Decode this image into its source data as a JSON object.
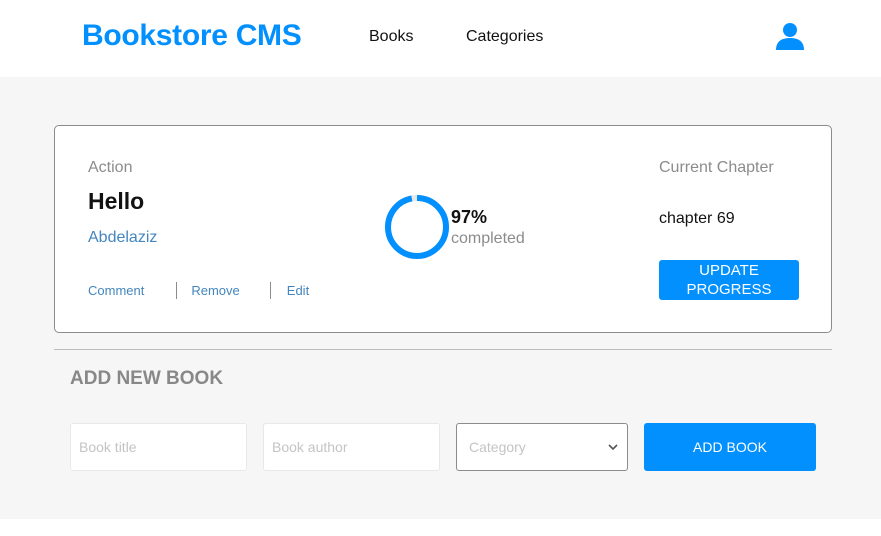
{
  "header": {
    "logo": "Bookstore CMS",
    "nav": [
      {
        "label": "Books"
      },
      {
        "label": "Categories"
      }
    ],
    "user_icon": "user-icon"
  },
  "book": {
    "genre": "Action",
    "title": "Hello",
    "author": "Abdelaziz",
    "actions": [
      "Comment",
      "Remove",
      "Edit"
    ],
    "progress_percent": "97%",
    "progress_value": 0.97,
    "progress_label": "completed",
    "current_chapter_label": "Current Chapter",
    "current_chapter": "chapter 69",
    "update_button": "UPDATE PROGRESS"
  },
  "form": {
    "title": "ADD NEW BOOK",
    "title_placeholder": "Book title",
    "author_placeholder": "Book author",
    "category_placeholder": "Category",
    "submit_label": "ADD BOOK"
  },
  "colors": {
    "accent": "#0290ff",
    "link": "#4386bf",
    "muted": "#8c8c8c",
    "background": "#f6f6f6"
  }
}
